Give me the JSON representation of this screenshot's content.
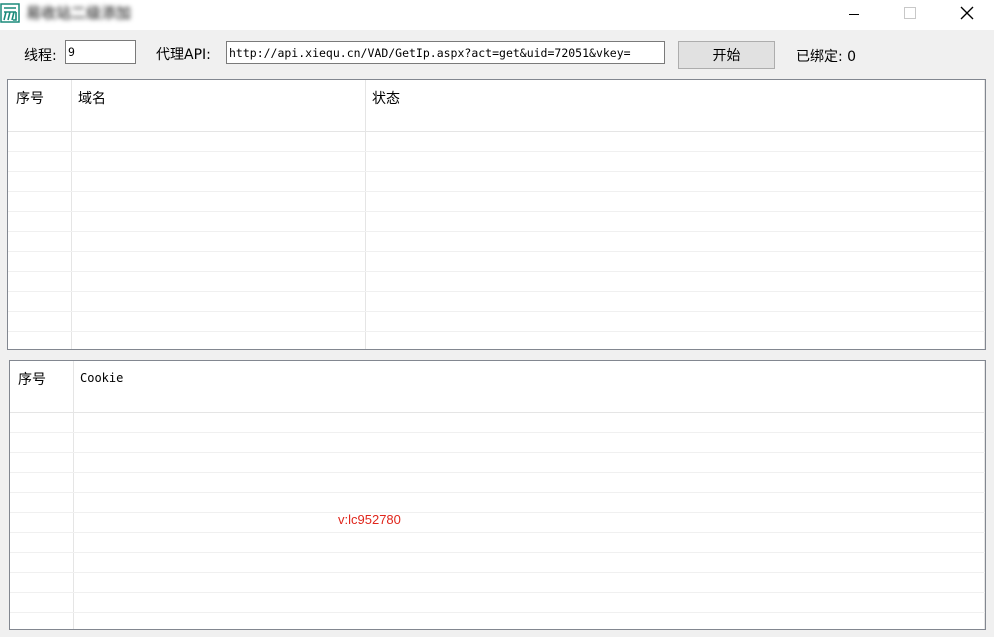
{
  "window": {
    "title": "易收站二级添加",
    "minimize_icon": "minimize-icon",
    "maximize_icon": "maximize-icon",
    "close_icon": "close-icon"
  },
  "toolbar": {
    "threads_label": "线程:",
    "threads_value": "9",
    "proxy_label": "代理API:",
    "proxy_value": "http://api.xiequ.cn/VAD/GetIp.aspx?act=get&uid=72051&vkey=",
    "start_button": "开始",
    "bound_label": "已绑定: 0"
  },
  "domain_table": {
    "columns": [
      "序号",
      "域名",
      "状态"
    ],
    "rows": []
  },
  "cookie_table": {
    "columns": [
      "序号",
      "Cookie"
    ],
    "rows": []
  },
  "watermark": "v:lc952780",
  "colors": {
    "watermark": "#e0261c",
    "app_icon": "#1a8a7a"
  }
}
